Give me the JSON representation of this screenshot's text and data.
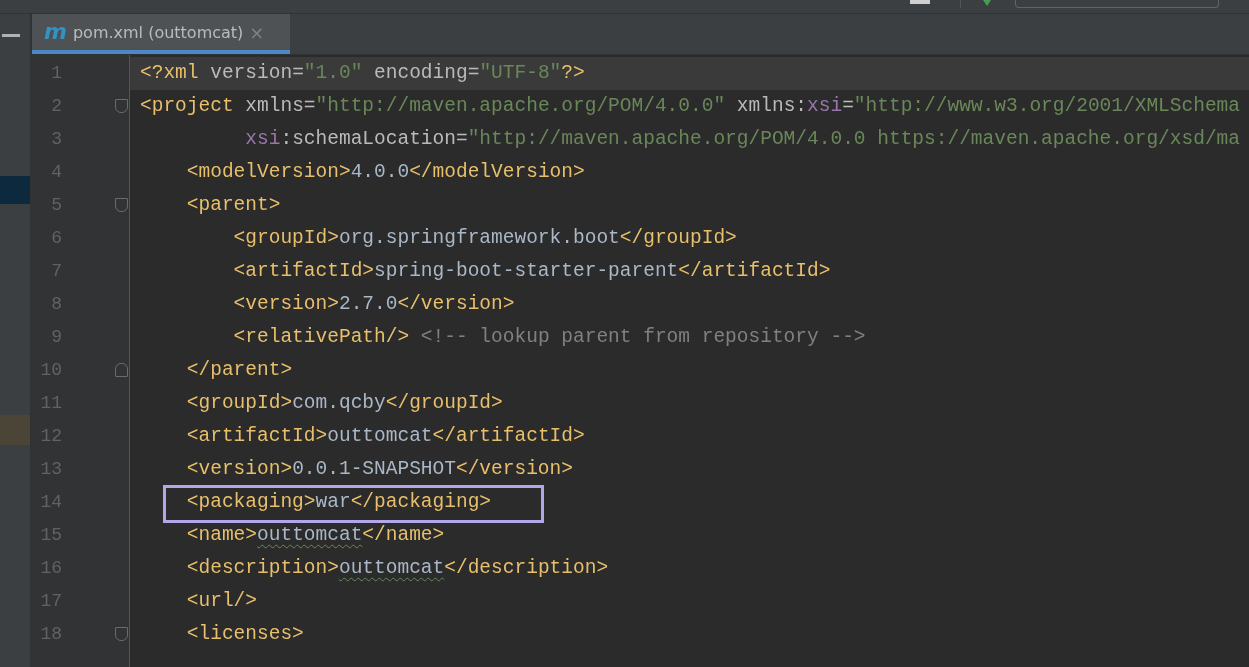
{
  "tab": {
    "icon": "m",
    "title": "pom.xml (outtomcat)",
    "close": "×",
    "selected": true
  },
  "editor": {
    "lines": [
      {
        "number": "1",
        "fold_start": false,
        "fold_end": false,
        "current": true,
        "boxed": false,
        "tokens": [
          {
            "kind": "tag",
            "text": "<?xml "
          },
          {
            "kind": "attr",
            "text": "version="
          },
          {
            "kind": "value",
            "text": "\"1.0\""
          },
          {
            "kind": "attr",
            "text": " encoding="
          },
          {
            "kind": "value",
            "text": "\"UTF-8\""
          },
          {
            "kind": "tag",
            "text": "?>"
          }
        ]
      },
      {
        "number": "2",
        "fold_start": true,
        "fold_end": false,
        "current": false,
        "boxed": false,
        "tokens": [
          {
            "kind": "tag",
            "text": "<project "
          },
          {
            "kind": "attr",
            "text": "xmlns="
          },
          {
            "kind": "value",
            "text": "\"http://maven.apache.org/POM/4.0.0\""
          },
          {
            "kind": "attr",
            "text": " xmlns:"
          },
          {
            "kind": "ns",
            "text": "xsi"
          },
          {
            "kind": "attr",
            "text": "="
          },
          {
            "kind": "value",
            "text": "\"http://www.w3.org/2001/XMLSchema"
          }
        ]
      },
      {
        "number": "3",
        "fold_start": false,
        "fold_end": false,
        "current": false,
        "boxed": false,
        "tokens": [
          {
            "kind": "ns",
            "text": "         xsi"
          },
          {
            "kind": "attr",
            "text": ":schemaLocation="
          },
          {
            "kind": "value",
            "text": "\"http://maven.apache.org/POM/4.0.0 https://maven.apache.org/xsd/ma"
          }
        ]
      },
      {
        "number": "4",
        "fold_start": false,
        "fold_end": false,
        "current": false,
        "boxed": false,
        "tokens": [
          {
            "kind": "tag",
            "text": "    <modelVersion>"
          },
          {
            "kind": "text",
            "text": "4.0.0"
          },
          {
            "kind": "tag",
            "text": "</modelVersion>"
          }
        ]
      },
      {
        "number": "5",
        "fold_start": true,
        "fold_end": false,
        "current": false,
        "boxed": false,
        "tokens": [
          {
            "kind": "tag",
            "text": "    <parent>"
          }
        ]
      },
      {
        "number": "6",
        "fold_start": false,
        "fold_end": false,
        "current": false,
        "boxed": false,
        "tokens": [
          {
            "kind": "tag",
            "text": "        <groupId>"
          },
          {
            "kind": "text",
            "text": "org.springframework.boot"
          },
          {
            "kind": "tag",
            "text": "</groupId>"
          }
        ]
      },
      {
        "number": "7",
        "fold_start": false,
        "fold_end": false,
        "current": false,
        "boxed": false,
        "tokens": [
          {
            "kind": "tag",
            "text": "        <artifactId>"
          },
          {
            "kind": "text",
            "text": "spring-boot-starter-parent"
          },
          {
            "kind": "tag",
            "text": "</artifactId>"
          }
        ]
      },
      {
        "number": "8",
        "fold_start": false,
        "fold_end": false,
        "current": false,
        "boxed": false,
        "tokens": [
          {
            "kind": "tag",
            "text": "        <version>"
          },
          {
            "kind": "text",
            "text": "2.7.0"
          },
          {
            "kind": "tag",
            "text": "</version>"
          }
        ]
      },
      {
        "number": "9",
        "fold_start": false,
        "fold_end": false,
        "current": false,
        "boxed": false,
        "tokens": [
          {
            "kind": "tag",
            "text": "        <relativePath/>"
          },
          {
            "kind": "comment",
            "text": " <!-- lookup parent from repository -->"
          }
        ]
      },
      {
        "number": "10",
        "fold_start": false,
        "fold_end": true,
        "current": false,
        "boxed": false,
        "tokens": [
          {
            "kind": "tag",
            "text": "    </parent>"
          }
        ]
      },
      {
        "number": "11",
        "fold_start": false,
        "fold_end": false,
        "current": false,
        "boxed": false,
        "tokens": [
          {
            "kind": "tag",
            "text": "    <groupId>"
          },
          {
            "kind": "text",
            "text": "com.qcby"
          },
          {
            "kind": "tag",
            "text": "</groupId>"
          }
        ]
      },
      {
        "number": "12",
        "fold_start": false,
        "fold_end": false,
        "current": false,
        "boxed": false,
        "tokens": [
          {
            "kind": "tag",
            "text": "    <artifactId>"
          },
          {
            "kind": "text",
            "text": "outtomcat"
          },
          {
            "kind": "tag",
            "text": "</artifactId>"
          }
        ]
      },
      {
        "number": "13",
        "fold_start": false,
        "fold_end": false,
        "current": false,
        "boxed": false,
        "tokens": [
          {
            "kind": "tag",
            "text": "    <version>"
          },
          {
            "kind": "text",
            "text": "0.0.1-SNAPSHOT"
          },
          {
            "kind": "tag",
            "text": "</version>"
          }
        ]
      },
      {
        "number": "14",
        "fold_start": false,
        "fold_end": false,
        "current": false,
        "boxed": true,
        "tokens": [
          {
            "kind": "tag",
            "text": "    <packaging>"
          },
          {
            "kind": "text",
            "text": "war"
          },
          {
            "kind": "tag",
            "text": "</packaging>"
          }
        ]
      },
      {
        "number": "15",
        "fold_start": false,
        "fold_end": false,
        "current": false,
        "boxed": false,
        "tokens": [
          {
            "kind": "tag",
            "text": "    <name>"
          },
          {
            "kind": "warn",
            "text": "outtomcat"
          },
          {
            "kind": "tag",
            "text": "</name>"
          }
        ]
      },
      {
        "number": "16",
        "fold_start": false,
        "fold_end": false,
        "current": false,
        "boxed": false,
        "tokens": [
          {
            "kind": "tag",
            "text": "    <description>"
          },
          {
            "kind": "warn",
            "text": "outtomcat"
          },
          {
            "kind": "tag",
            "text": "</description>"
          }
        ]
      },
      {
        "number": "17",
        "fold_start": false,
        "fold_end": false,
        "current": false,
        "boxed": false,
        "tokens": [
          {
            "kind": "tag",
            "text": "    <url/>"
          }
        ]
      },
      {
        "number": "18",
        "fold_start": true,
        "fold_end": false,
        "current": false,
        "boxed": false,
        "tokens": [
          {
            "kind": "tag",
            "text": "    <licenses>"
          }
        ]
      }
    ]
  }
}
